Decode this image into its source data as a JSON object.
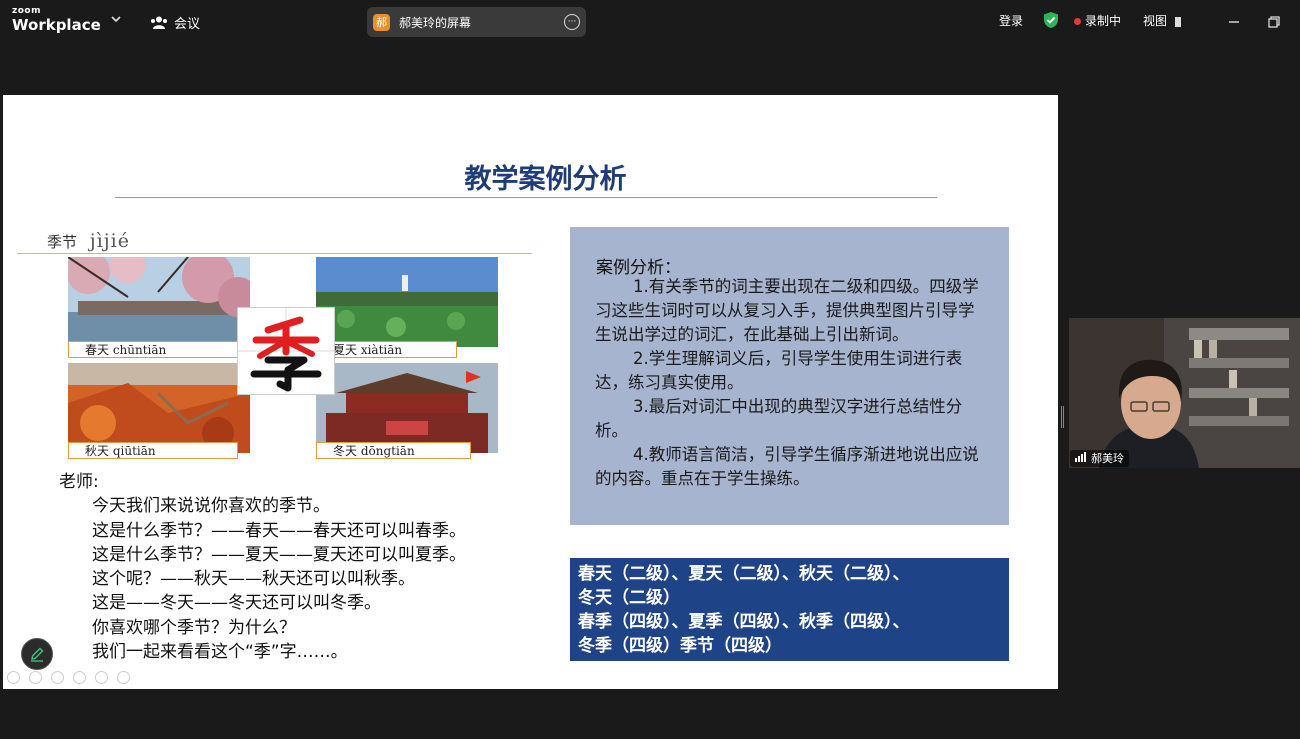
{
  "topbar": {
    "brand_small": "zoom",
    "brand_main": "Workplace",
    "meeting_label": "会议",
    "share_avatar": "郝",
    "share_title": "郝美玲的屏幕",
    "share_more": "···",
    "login": "登录",
    "recording": "录制中",
    "view": "视图",
    "icons": [
      "chevron-down-icon",
      "people-icon",
      "more-icon",
      "shield-check-icon",
      "record-dot-icon",
      "view-icon",
      "minimize-icon",
      "restore-icon"
    ],
    "colors": {
      "bar": "#1a1a1a",
      "pill": "#3a3a3a",
      "avatar": "#e8902a",
      "shield": "#2fb45a",
      "record": "#e53935"
    }
  },
  "slide": {
    "title": "教学案例分析",
    "word_header": {
      "hanzi": "季节",
      "pinyin": "jìjié"
    },
    "captions": {
      "spring": "春天 chūntiān",
      "summer": "夏天 xiàtiān",
      "autumn": "秋天 qiūtiān",
      "winter": "冬天 dōngtiān"
    },
    "big_character": "季",
    "teacher_label": "老师:",
    "teacher_lines": [
      "今天我们来说说你喜欢的季节。",
      "这是什么季节？——春天——春天还可以叫春季。",
      "这是什么季节？——夏天——夏天还可以叫夏季。",
      "这个呢？——秋天——秋天还可以叫秋季。",
      "这是——冬天——冬天还可以叫冬季。",
      "你喜欢哪个季节？为什么？",
      "我们一起来看看这个“季”字……。"
    ],
    "analysis": {
      "title": "案例分析：",
      "paragraphs": [
        "1.有关季节的词主要出现在二级和四级。四级学习这些生词时可以从复习入手，提供典型图片引导学生说出学过的词汇，在此基础上引出新词。",
        "2.学生理解词义后，引导学生使用生词进行表达，练习真实使用。",
        "3.最后对词汇中出现的典型汉字进行总结性分析。",
        "4.教师语言简洁，引导学生循序渐进地说出应说的内容。重点在于学生操练。"
      ]
    },
    "word_list_lines": [
      "春天（二级）、夏天（二级）、秋天（二级）、",
      "冬天（二级）",
      "春季（四级）、夏季（四级）、秋季（四级）、",
      "冬季（四级）季节（四级）"
    ],
    "colors": {
      "title": "#1f3c78",
      "analysis_bg": "#a7b4cf",
      "words_bg": "#1f4387",
      "char_top": "#e02020"
    }
  },
  "video": {
    "participant_name": "郝美玲",
    "icons": [
      "signal-bars-icon"
    ]
  },
  "tools": {
    "icons": [
      "annotate-pencil-icon"
    ]
  }
}
